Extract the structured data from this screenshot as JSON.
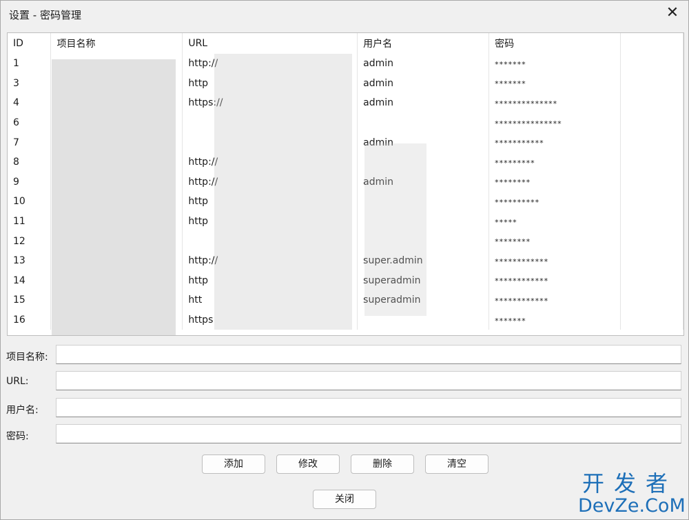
{
  "window": {
    "title": "设置 - 密码管理",
    "close_symbol": "✕"
  },
  "table": {
    "headers": [
      "ID",
      "项目名称",
      "URL",
      "用户名",
      "密码"
    ],
    "rows": [
      {
        "id": "1",
        "name": "",
        "url": "http://",
        "user": "admin",
        "pw": "*******"
      },
      {
        "id": "3",
        "name": "",
        "url": "http",
        "user": "admin",
        "pw": "*******"
      },
      {
        "id": "4",
        "name": "",
        "url": "https://",
        "user": "admin",
        "pw": "**************"
      },
      {
        "id": "6",
        "name": "",
        "url": "",
        "user": "",
        "pw": "***************"
      },
      {
        "id": "7",
        "name": "",
        "url": "",
        "user": "admin",
        "pw": "***********"
      },
      {
        "id": "8",
        "name": "",
        "url": "http://",
        "user": "",
        "pw": "*********"
      },
      {
        "id": "9",
        "name": "",
        "url": "http://",
        "user": "admin",
        "pw": "********"
      },
      {
        "id": "10",
        "name": "",
        "url": "http",
        "user": "",
        "pw": "**********"
      },
      {
        "id": "11",
        "name": "",
        "url": "http",
        "user": "",
        "pw": "*****"
      },
      {
        "id": "12",
        "name": "",
        "url": "",
        "user": "",
        "pw": "********"
      },
      {
        "id": "13",
        "name": "",
        "url": "http://",
        "user": "super.admin",
        "pw": "************"
      },
      {
        "id": "14",
        "name": "",
        "url": "http",
        "user": "superadmin",
        "pw": "************"
      },
      {
        "id": "15",
        "name": "",
        "url": "htt",
        "user": "superadmin",
        "pw": "************"
      },
      {
        "id": "16",
        "name": "",
        "url": "https",
        "user": "",
        "pw": "*******"
      }
    ]
  },
  "form": {
    "name_label": "项目名称:",
    "url_label": "URL:",
    "user_label": "用户名:",
    "pw_label": "密码:"
  },
  "buttons": {
    "add": "添加",
    "edit": "修改",
    "delete": "删除",
    "clear": "清空",
    "close": "关闭"
  },
  "watermark": {
    "line1": "开发者",
    "line2": "DevZe.CoM",
    "color": "#1d6fb8"
  }
}
